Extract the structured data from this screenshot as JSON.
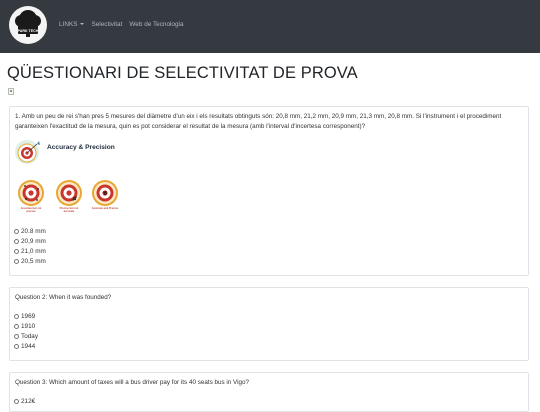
{
  "navbar": {
    "logo_text": "PARK TECH",
    "links": [
      {
        "label": "LINKS",
        "has_caret": true
      },
      {
        "label": "Selectivitat",
        "has_caret": false
      },
      {
        "label": "Web de Tecnologia",
        "has_caret": false
      }
    ]
  },
  "page": {
    "title": "QÜESTIONARI DE SELECTIVITAT DE PROVA"
  },
  "questions": [
    {
      "text": "1. Amb un peu de rei s'han pres 5 mesures del diàmetre d'un eix i els resultats obtinguts són: 20,8 mm, 21,2 mm, 20,9 mm, 21,3 mm, 20,8 mm. Si l'instrument i el procediment garanteixen l'exactitud de la mesura, quin es pot considerar el resultat de la mesura (amb l'interval d'incertesa corresponent)?",
      "figure": {
        "title": "Accuracy & Precision",
        "captions": [
          "Accurate but not precise",
          "Precise but not accurate",
          "Accurate and Precise"
        ]
      },
      "options": [
        "20.8 mm",
        "20,9 mm",
        "21,0 mm",
        "20,5 mm"
      ]
    },
    {
      "text": "Question 2: When it was founded?",
      "options": [
        "1969",
        "1910",
        "Today",
        "1944"
      ]
    },
    {
      "text": "Question 3: Which amount of taxes will a bus driver pay for its 40 seats bus in Vigo?",
      "options": [
        "212€"
      ]
    }
  ],
  "colors": {
    "navbar_bg": "#343a40",
    "nav_link": "#aeb4bb",
    "target_red": "#c8362e",
    "target_gold": "#e8a634"
  }
}
